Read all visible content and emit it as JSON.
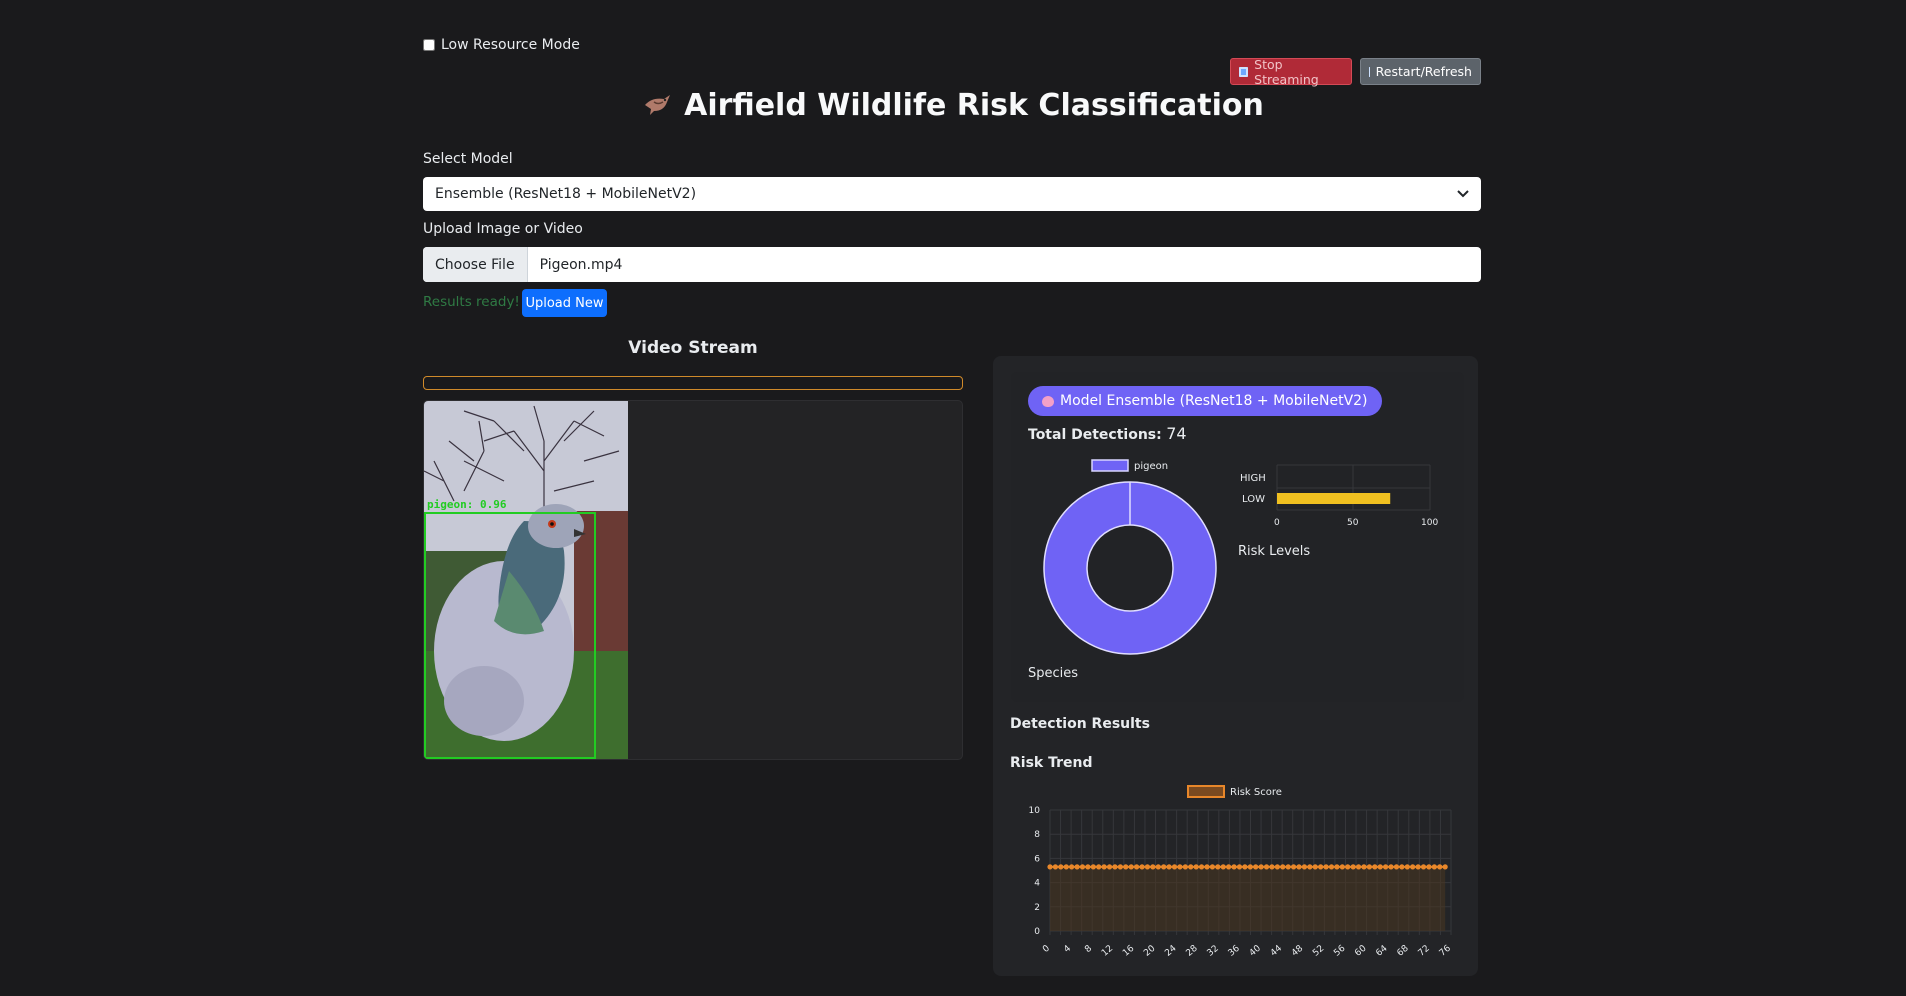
{
  "low_resource": {
    "label": "Low Resource Mode",
    "checked": false
  },
  "buttons": {
    "stop": "Stop Streaming",
    "restart": "Restart/Refresh",
    "upload_new": "Upload New"
  },
  "title": "Airfield Wildlife Risk Classification",
  "select_model": {
    "label": "Select Model",
    "value": "Ensemble (ResNet18 + MobileNetV2)"
  },
  "upload": {
    "label": "Upload Image or Video",
    "choose": "Choose File",
    "filename": "Pigeon.mp4",
    "status": "Results ready!"
  },
  "video": {
    "title": "Video Stream",
    "detection_label": "pigeon: 0.96"
  },
  "results": {
    "model_badge": "Model Ensemble (ResNet18 + MobileNetV2)",
    "total_label": "Total Detections:",
    "total_value": "74",
    "species_label": "Species",
    "risk_levels_label": "Risk Levels",
    "detection_results": "Detection Results",
    "risk_trend": "Risk Trend"
  },
  "colors": {
    "accent": "#6f63f5",
    "risk_bar": "#f0c020",
    "trend": "#e8872a",
    "bbox": "#22cc22"
  },
  "chart_data": [
    {
      "type": "pie",
      "legend": [
        "pigeon"
      ],
      "values": [
        74
      ],
      "color": "#6f63f5"
    },
    {
      "type": "bar",
      "orientation": "horizontal",
      "categories": [
        "HIGH",
        "LOW"
      ],
      "values": [
        0,
        74
      ],
      "xlim": [
        0,
        100
      ],
      "xticks": [
        "0",
        "50",
        "100"
      ]
    },
    {
      "type": "line",
      "legend": [
        "Risk Score"
      ],
      "ylim": [
        0,
        10
      ],
      "yticks": [
        "0",
        "2",
        "4",
        "6",
        "8",
        "10"
      ],
      "xticks": [
        "0",
        "4",
        "8",
        "12",
        "16",
        "20",
        "24",
        "28",
        "32",
        "36",
        "40",
        "44",
        "48",
        "52",
        "56",
        "60",
        "64",
        "68",
        "72",
        "76"
      ],
      "x_count": 74,
      "y_value": 5.3
    }
  ]
}
